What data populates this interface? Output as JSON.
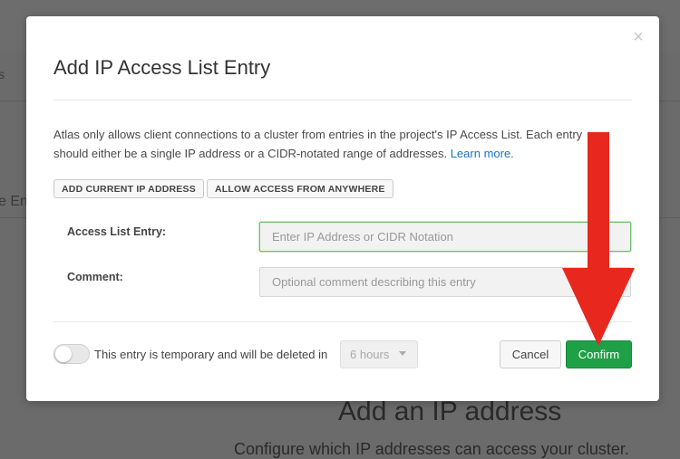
{
  "background": {
    "left_fragment_1": "s",
    "left_fragment_2": "e En",
    "heading": "Add an IP address",
    "subheading": "Configure which IP addresses can access your cluster."
  },
  "modal": {
    "title": "Add IP Access List Entry",
    "close_symbol": "×",
    "description": "Atlas only allows client connections to a cluster from entries in the project's IP Access List. Each entry should either be a single IP address or a CIDR-notated range of addresses.",
    "learn_more": "Learn more.",
    "add_current_ip_label": "ADD CURRENT IP ADDRESS",
    "allow_anywhere_label": "ALLOW ACCESS FROM ANYWHERE",
    "access_list_label": "Access List Entry:",
    "access_list_placeholder": "Enter IP Address or CIDR Notation",
    "comment_label": "Comment:",
    "comment_placeholder": "Optional comment describing this entry",
    "temporary_text": "This entry is temporary and will be deleted in",
    "temporary_enabled": false,
    "duration_value": "6 hours",
    "cancel_label": "Cancel",
    "confirm_label": "Confirm"
  },
  "colors": {
    "confirm": "#1fa046",
    "link": "#1a74c5",
    "annotation_arrow": "#e8281e",
    "focus_border": "#6cc067"
  }
}
